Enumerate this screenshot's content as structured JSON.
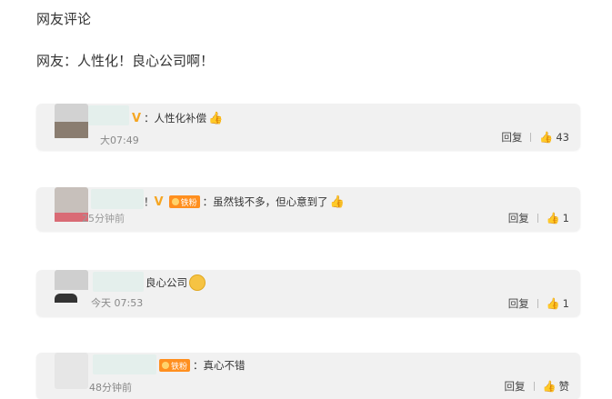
{
  "header": {
    "title": "网友评论",
    "subtitle": "网友：人性化！良心公司啊！"
  },
  "comments": [
    {
      "content": "：人性化补偿",
      "time": "大07:49",
      "reply": "回复",
      "likes": "43"
    },
    {
      "prefix": "！",
      "content": "：虽然钱不多，但心意到了",
      "badge": "铁粉",
      "time": "25分钟前",
      "reply": "回复",
      "likes": "1"
    },
    {
      "content": "良心公司",
      "time": "今天 07:53",
      "reply": "回复",
      "likes": "1"
    },
    {
      "content": "：真心不错",
      "badge": "铁粉",
      "time": "48分钟前",
      "reply": "回复",
      "likes": "赞"
    }
  ],
  "icons": {
    "like": "thumbs-up-icon",
    "verified": "v-badge-icon"
  },
  "colors": {
    "card_bg": "#f1f1f1",
    "verified": "#f5a623",
    "fan_badge": "#ff8f1f"
  }
}
